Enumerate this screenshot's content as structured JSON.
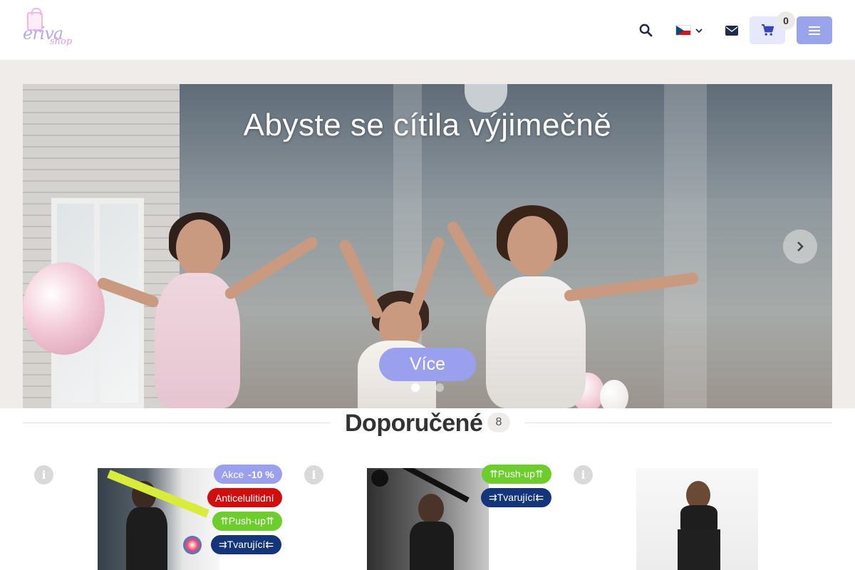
{
  "header": {
    "logo_text": "eriva",
    "logo_sub": "shop",
    "cart_count": "0",
    "language": "cs"
  },
  "hero": {
    "title": "Abyste se cítila výjimečně",
    "cta_label": "Více",
    "slides": 2,
    "active_slide": 1
  },
  "section": {
    "title": "Doporučené",
    "count": "8"
  },
  "products": [
    {
      "badges": [
        {
          "text": "Akce",
          "extra": "-10 %",
          "color": "#9aa0ee"
        },
        {
          "text": "Anticelulitidní",
          "color": "#d10e0e"
        },
        {
          "text": "⇈Push-up⇈",
          "color": "#6ccd2c"
        },
        {
          "text": "⇉Tvarující⇇",
          "color": "#15357a"
        }
      ]
    },
    {
      "badges": [
        {
          "text": "⇈Push-up⇈",
          "color": "#6ccd2c"
        },
        {
          "text": "⇉Tvarující⇇",
          "color": "#15357a"
        }
      ]
    },
    {
      "badges": []
    }
  ],
  "icons": {
    "search": "search-icon",
    "flag": "czech-flag-icon",
    "chevron": "chevron-down-icon",
    "mail": "envelope-icon",
    "cart": "cart-icon",
    "menu": "menu-icon",
    "next": "chevron-right-icon",
    "info": "info-icon"
  },
  "colors": {
    "accent": "#9aa0ee",
    "cart_bg": "#e6e9fb",
    "badge_red": "#d10e0e",
    "badge_green": "#6ccd2c",
    "badge_navy": "#15357a"
  }
}
